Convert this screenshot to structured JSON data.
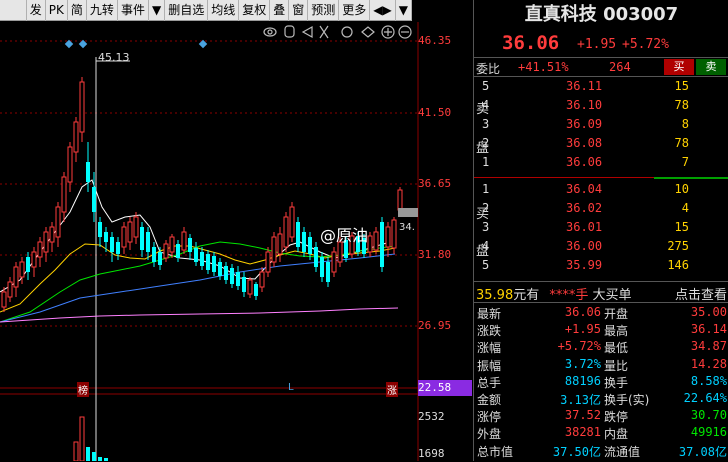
{
  "toolbar": {
    "items": [
      "发",
      "PK",
      "简",
      "九转",
      "事件",
      "▼",
      "删自选",
      "均线",
      "复权",
      "叠",
      "窗",
      "预测",
      "更多",
      "◀▶",
      "▼"
    ]
  },
  "chart": {
    "price_ticks": [
      "46.35",
      "41.50",
      "36.65",
      "31.80",
      "26.95",
      "22.58"
    ],
    "vol_ticks": [
      "2532",
      "1698"
    ],
    "high_label": "45.13",
    "right_label": "34.",
    "marker_labels": [
      "榜",
      "L",
      "涨"
    ],
    "watermark": "@原油",
    "colors": {
      "up": "#ff3c3c",
      "down": "#00ffff",
      "ma1": "#ffffff",
      "ma2": "#ffd200",
      "ma3": "#ff80ff",
      "ma4": "#00e600",
      "cur_price_bg": "#8a2be2"
    }
  },
  "stock": {
    "name": "直真科技",
    "code": "003007",
    "price": "36.06",
    "change": "+1.95",
    "change_pct": "+5.72%"
  },
  "weibi": {
    "label": "委比",
    "value": "+41.51%",
    "count": "264",
    "buy_btn": "买",
    "sell_btn": "卖"
  },
  "sell_side": {
    "label1": "卖",
    "label2": "盘",
    "rows": [
      {
        "lv": "5",
        "price": "36.11",
        "vol": "15"
      },
      {
        "lv": "4",
        "price": "36.10",
        "vol": "78"
      },
      {
        "lv": "3",
        "price": "36.09",
        "vol": "8"
      },
      {
        "lv": "2",
        "price": "36.08",
        "vol": "78"
      },
      {
        "lv": "1",
        "price": "36.06",
        "vol": "7"
      }
    ]
  },
  "buy_side": {
    "label1": "买",
    "label2": "盘",
    "rows": [
      {
        "lv": "1",
        "price": "36.04",
        "vol": "10"
      },
      {
        "lv": "2",
        "price": "36.02",
        "vol": "4"
      },
      {
        "lv": "3",
        "price": "36.01",
        "vol": "15"
      },
      {
        "lv": "4",
        "price": "36.00",
        "vol": "275"
      },
      {
        "lv": "5",
        "price": "35.99",
        "vol": "146"
      }
    ]
  },
  "big_order": {
    "price": "35.98",
    "unit": "元有",
    "hands": "****手",
    "label": "大买单",
    "link": "点击查看"
  },
  "stats": [
    {
      "k1": "最新",
      "v1": "36.06",
      "c1": "red",
      "k2": "开盘",
      "v2": "35.00",
      "c2": "red"
    },
    {
      "k1": "涨跌",
      "v1": "+1.95",
      "c1": "red",
      "k2": "最高",
      "v2": "36.14",
      "c2": "red"
    },
    {
      "k1": "涨幅",
      "v1": "+5.72%",
      "c1": "red",
      "k2": "最低",
      "v2": "34.87",
      "c2": "red"
    },
    {
      "k1": "振幅",
      "v1": "3.72%",
      "c1": "cyan",
      "k2": "量比",
      "v2": "14.28",
      "c2": "red"
    },
    {
      "k1": "总手",
      "v1": "88196",
      "c1": "cyan",
      "k2": "换手",
      "v2": "8.58%",
      "c2": "cyan"
    },
    {
      "k1": "金额",
      "v1": "3.13亿",
      "c1": "cyan",
      "k2": "换手(实)",
      "v2": "22.64%",
      "c2": "cyan"
    },
    {
      "k1": "涨停",
      "v1": "37.52",
      "c1": "red",
      "k2": "跌停",
      "v2": "30.70",
      "c2": "green"
    },
    {
      "k1": "外盘",
      "v1": "38281",
      "c1": "red",
      "k2": "内盘",
      "v2": "49916",
      "c2": "green"
    },
    {
      "k1": "总市值",
      "v1": "37.50亿",
      "c1": "cyan",
      "k2": "流通值",
      "v2": "37.08亿",
      "c2": "cyan"
    }
  ]
}
